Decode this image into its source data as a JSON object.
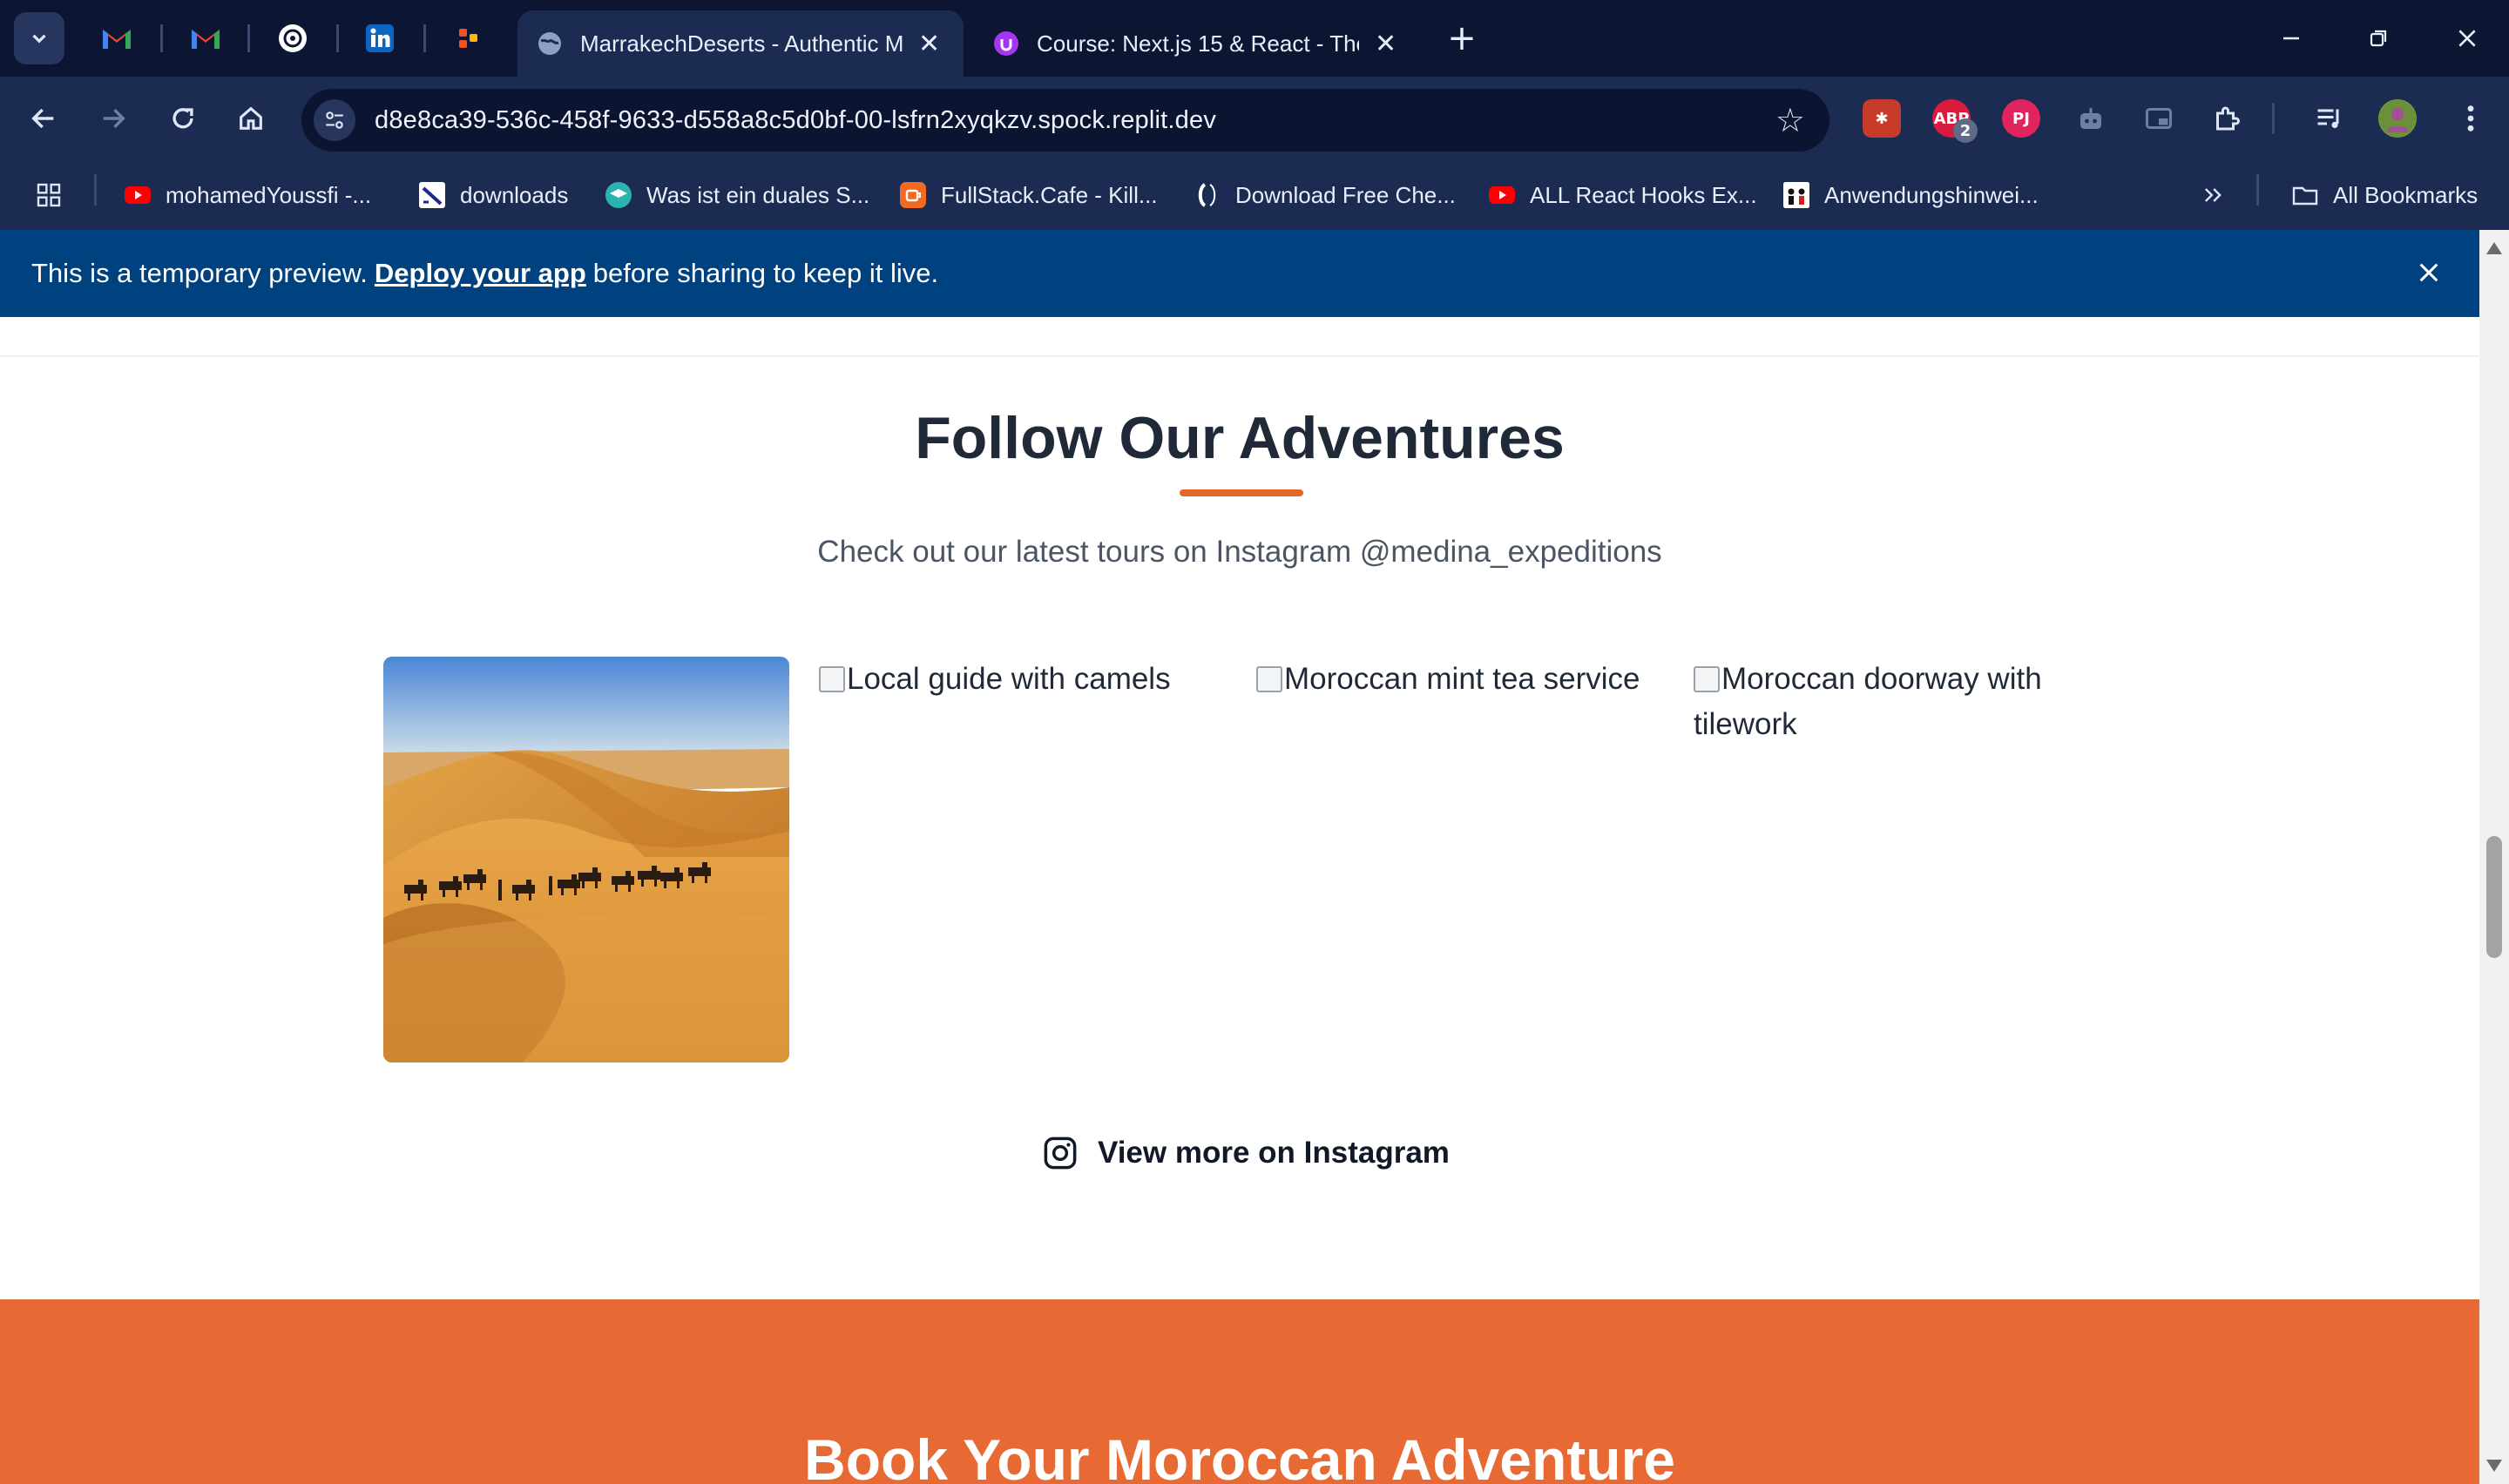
{
  "browser": {
    "tabs": [
      {
        "title": "MarrakechDeserts - Authentic M",
        "active": true
      },
      {
        "title": "Course: Next.js 15 & React - The",
        "active": false
      }
    ],
    "url": "d8e8ca39-536c-458f-9633-d558a8c5d0bf-00-lsfrn2xyqkzv.spock.replit.dev",
    "extension_badge": "2",
    "bookmarks": [
      {
        "label": "mohamedYoussfi -..."
      },
      {
        "label": "downloads"
      },
      {
        "label": "Was ist ein duales S..."
      },
      {
        "label": "FullStack.Cafe - Kill..."
      },
      {
        "label": "Download Free Che..."
      },
      {
        "label": "ALL React Hooks Ex..."
      },
      {
        "label": "Anwendungshinwei..."
      }
    ],
    "all_bookmarks": "All Bookmarks"
  },
  "banner": {
    "text_before": "This is a temporary preview.",
    "link": "Deploy your app",
    "text_after": "before sharing to keep it live."
  },
  "gallery": {
    "title": "Follow Our Adventures",
    "subtitle": "Check out our latest tours on Instagram @medina_expeditions",
    "alts": [
      "Local guide with camels",
      "Moroccan mint tea service",
      "Moroccan doorway with tilework"
    ],
    "cta": "View more on Instagram",
    "accent": "#e4672c"
  },
  "booking": {
    "title": "Book Your Moroccan Adventure",
    "bg": "#e76a34"
  }
}
